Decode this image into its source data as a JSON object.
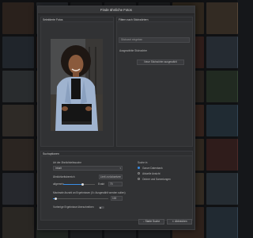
{
  "dialog": {
    "title": "Finde ähnliche Fotos"
  },
  "photo_panel": {
    "title": "Selektierte Fotos"
  },
  "filter_panel": {
    "title": "Filtern nach Stichwörtern",
    "keyword_placeholder": "Stichwort eingeben",
    "selected_label": "Ausgewählte Stichwörter",
    "clear_button": "Neue Stichwörter ausgewählt"
  },
  "settings_panel": {
    "title": "Suchoptionen",
    "similarity_label": "Art der Ähnlichkeitssuche",
    "similarity_value": "Inhalt",
    "threshold_label": "Ähnlichkeitsbereich",
    "reset_button": "Limit zurücksetzen",
    "min_label": "allgemein",
    "min_value": "85",
    "max_label": "Exakt",
    "max_value": "70",
    "maxresults_label": "Maximale Anzahl an Ergebnissen (0= Ausgewählt werden sollen)",
    "maxresults_value": "100",
    "search_in_label": "Suche in",
    "search_in_options": [
      "Ganze Datenbank",
      "Aktuelle Ansicht",
      "Ordner und Sammlungen"
    ],
    "search_in_selected": 0,
    "exclude_label": "Vorherige Ergebnisse überschreiben",
    "threshold_fraction": 0.6,
    "results_fraction": 0.05
  },
  "footer": {
    "search_button": "Starte Suche",
    "cancel_button": "Abbrechen"
  },
  "colors": {
    "accent": "#3a8ee6",
    "dialog_bg": "#2b2c2e"
  }
}
